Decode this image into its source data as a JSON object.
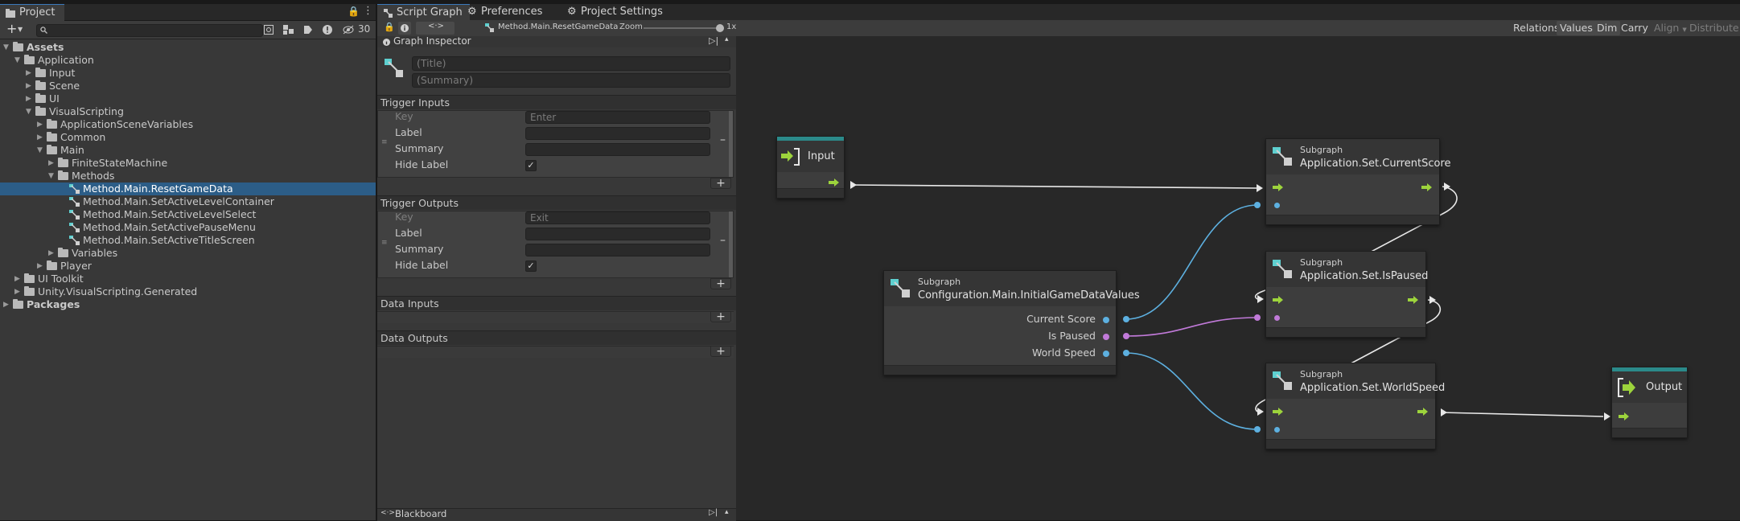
{
  "project_panel": {
    "tab_label": "Project",
    "hidden_count": "30",
    "tree": [
      {
        "label": "Assets",
        "depth": 0,
        "expanded": true,
        "bold": true,
        "type": "folder"
      },
      {
        "label": "Application",
        "depth": 1,
        "expanded": true,
        "type": "folder"
      },
      {
        "label": "Input",
        "depth": 2,
        "expanded": false,
        "type": "folder"
      },
      {
        "label": "Scene",
        "depth": 2,
        "expanded": false,
        "type": "folder"
      },
      {
        "label": "UI",
        "depth": 2,
        "expanded": false,
        "type": "folder"
      },
      {
        "label": "VisualScripting",
        "depth": 2,
        "expanded": true,
        "type": "folder"
      },
      {
        "label": "ApplicationSceneVariables",
        "depth": 3,
        "expanded": false,
        "type": "folder"
      },
      {
        "label": "Common",
        "depth": 3,
        "expanded": false,
        "type": "folder"
      },
      {
        "label": "Main",
        "depth": 3,
        "expanded": true,
        "type": "folder"
      },
      {
        "label": "FiniteStateMachine",
        "depth": 4,
        "expanded": false,
        "type": "folder"
      },
      {
        "label": "Methods",
        "depth": 4,
        "expanded": true,
        "type": "folder"
      },
      {
        "label": "Method.Main.ResetGameData",
        "depth": 5,
        "type": "graph",
        "selected": true
      },
      {
        "label": "Method.Main.SetActiveLevelContainer",
        "depth": 5,
        "type": "graph"
      },
      {
        "label": "Method.Main.SetActiveLevelSelect",
        "depth": 5,
        "type": "graph"
      },
      {
        "label": "Method.Main.SetActivePauseMenu",
        "depth": 5,
        "type": "graph"
      },
      {
        "label": "Method.Main.SetActiveTitleScreen",
        "depth": 5,
        "type": "graph"
      },
      {
        "label": "Variables",
        "depth": 4,
        "expanded": false,
        "type": "folder"
      },
      {
        "label": "Player",
        "depth": 3,
        "expanded": false,
        "type": "folder"
      },
      {
        "label": "UI Toolkit",
        "depth": 1,
        "expanded": false,
        "type": "folder"
      },
      {
        "label": "Unity.VisualScripting.Generated",
        "depth": 1,
        "expanded": false,
        "type": "folder"
      },
      {
        "label": "Packages",
        "depth": 0,
        "expanded": false,
        "bold": true,
        "type": "folder"
      }
    ]
  },
  "graph_tabs": {
    "script_graph": "Script Graph",
    "preferences": "Preferences",
    "project_settings": "Project Settings"
  },
  "graph_toolbar": {
    "breadcrumb": "Method.Main.ResetGameData",
    "zoom_label": "Zoom",
    "zoom_value": "1x",
    "zoom_level": 1.0,
    "buttons": {
      "relations": "Relations",
      "values": "Values",
      "dim": "Dim",
      "carry": "Carry",
      "align": "Align",
      "distribute": "Distribute"
    }
  },
  "inspector": {
    "title": "Graph Inspector",
    "title_placeholder": "(Title)",
    "summary_placeholder": "(Summary)",
    "trigger_inputs": {
      "header": "Trigger Inputs",
      "key_label": "Key",
      "key_value": "Enter",
      "label_label": "Label",
      "summary_label": "Summary",
      "hide_label": "Hide Label",
      "hide_checked": true
    },
    "trigger_outputs": {
      "header": "Trigger Outputs",
      "key_label": "Key",
      "key_value": "Exit",
      "label_label": "Label",
      "summary_label": "Summary",
      "hide_label": "Hide Label",
      "hide_checked": true
    },
    "data_inputs": "Data Inputs",
    "data_outputs": "Data Outputs",
    "blackboard": "Blackboard"
  },
  "graph": {
    "input_node": {
      "title": "Input"
    },
    "output_node": {
      "title": "Output"
    },
    "config_node": {
      "kind": "Subgraph",
      "title": "Configuration.Main.InitialGameDataValues",
      "ports": [
        "Current Score",
        "Is Paused",
        "World Speed"
      ]
    },
    "set_score_node": {
      "kind": "Subgraph",
      "title": "Application.Set.CurrentScore"
    },
    "set_paused_node": {
      "kind": "Subgraph",
      "title": "Application.Set.IsPaused"
    },
    "set_speed_node": {
      "kind": "Subgraph",
      "title": "Application.Set.WorldSpeed"
    }
  },
  "colors": {
    "accent_green": "#9dd43c",
    "float_port": "#5db0e0",
    "bool_port": "#c17ad9",
    "selection": "#2c5d87",
    "teal_header": "#2b8a8a"
  }
}
